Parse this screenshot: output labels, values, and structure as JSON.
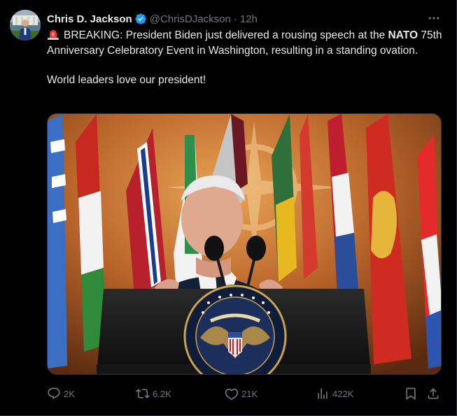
{
  "author": {
    "display_name": "Chris D. Jackson",
    "handle": "@ChrisDJackson",
    "separator": "·",
    "time": "12h",
    "verified": true
  },
  "post": {
    "paragraph1_prefix": "BREAKING: President Biden just delivered a rousing speech at the ",
    "paragraph1_bold": "NATO",
    "paragraph1_suffix": " 75th Anniversary Celebratory Event in Washington, resulting in a standing ovation.",
    "paragraph2": "World leaders love our president!",
    "emoji": "rotating-light-icon"
  },
  "media": {
    "description_icon": "photo"
  },
  "metrics": {
    "replies": "2K",
    "reposts": "6.2K",
    "likes": "21K",
    "views": "422K"
  },
  "colors": {
    "background": "#000000",
    "text_primary": "#e7e9ea",
    "text_secondary": "#71767b",
    "verified_blue": "#1d9bf0",
    "border": "#2f3336"
  }
}
